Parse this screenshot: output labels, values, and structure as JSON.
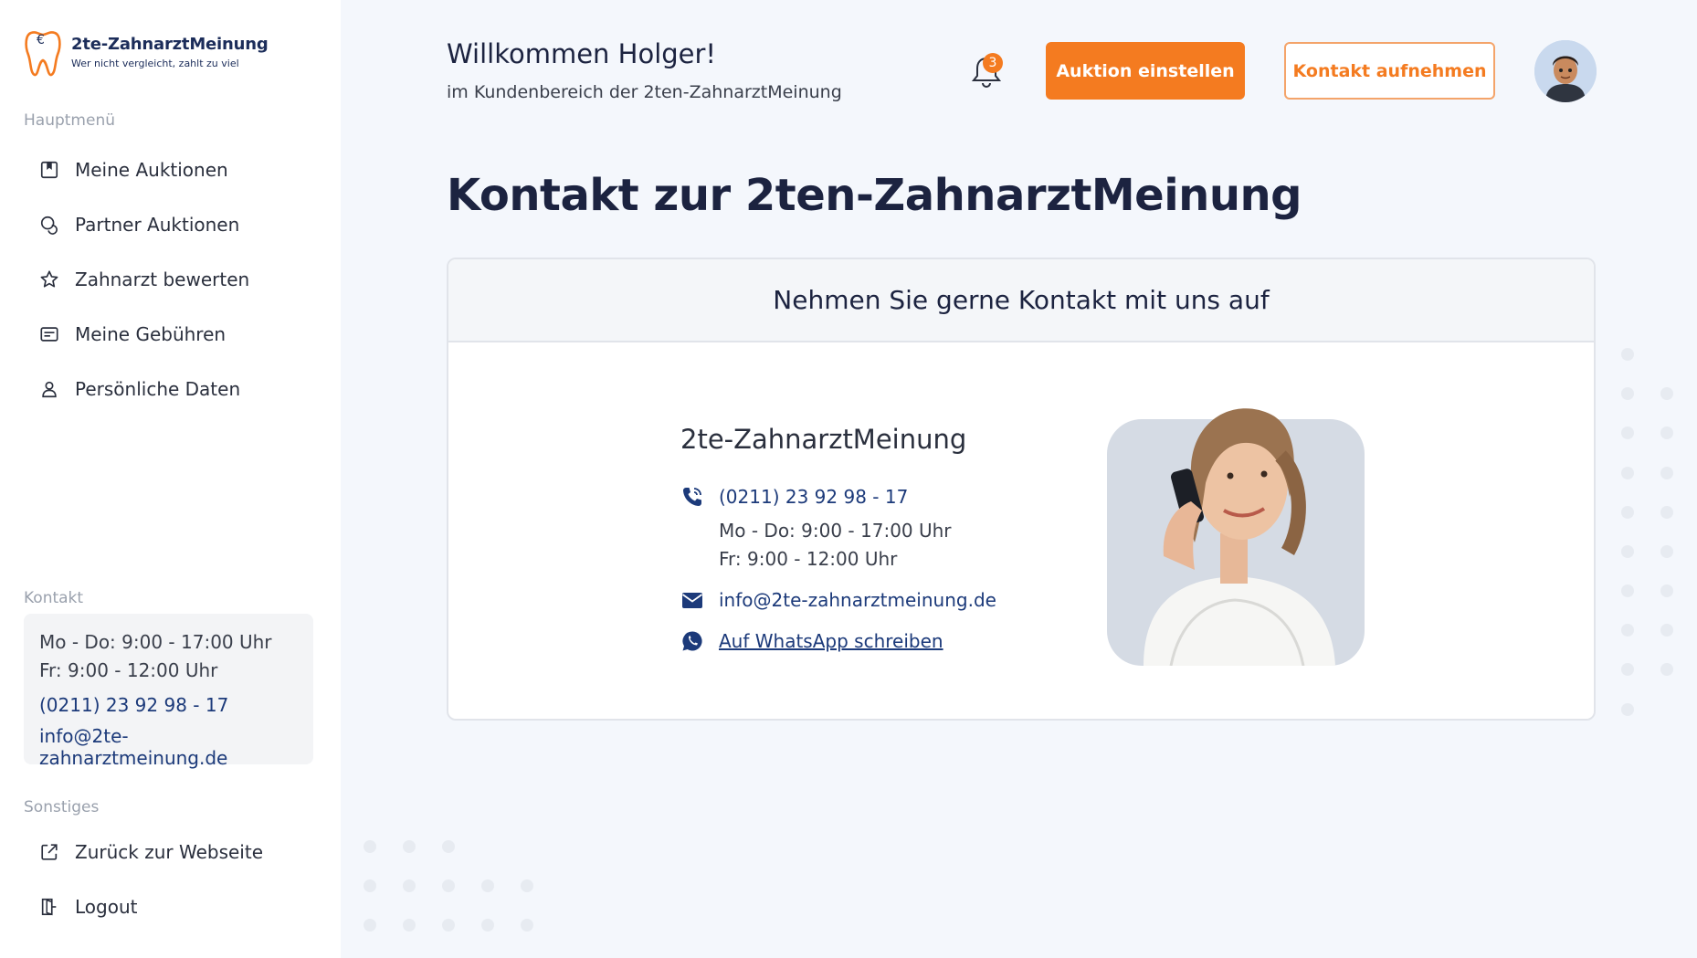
{
  "brand": {
    "name": "2te-ZahnarztMeinung",
    "tagline": "Wer nicht vergleicht, zahlt zu viel",
    "accent": "#f47b20",
    "navy": "#1c2d5a"
  },
  "sidebar": {
    "main_label": "Hauptmenü",
    "items": [
      {
        "label": "Meine Auktionen",
        "icon": "bookmark-icon"
      },
      {
        "label": "Partner Auktionen",
        "icon": "chat-bubbles-icon"
      },
      {
        "label": "Zahnarzt bewerten",
        "icon": "star-icon"
      },
      {
        "label": "Meine Gebühren",
        "icon": "card-icon"
      },
      {
        "label": "Persönliche Daten",
        "icon": "user-icon"
      }
    ],
    "contact_label": "Kontakt",
    "contact": {
      "hours_1": "Mo - Do: 9:00 - 17:00 Uhr",
      "hours_2": "Fr: 9:00 - 12:00 Uhr",
      "phone": "(0211) 23 92 98 - 17",
      "email": "info@2te-zahnarztmeinung.de"
    },
    "other_label": "Sonstiges",
    "other_items": [
      {
        "label": "Zurück zur Webseite",
        "icon": "external-link-icon"
      },
      {
        "label": "Logout",
        "icon": "logout-door-icon"
      }
    ]
  },
  "header": {
    "greeting": "Willkommen Holger!",
    "subtitle": "im Kundenbereich der 2ten-ZahnarztMeinung",
    "notification_count": "3",
    "primary_button": "Auktion einstellen",
    "secondary_button": "Kontakt aufnehmen"
  },
  "page": {
    "title": "Kontakt zur 2ten-ZahnarztMeinung"
  },
  "card": {
    "heading": "Nehmen Sie gerne Kontakt mit uns auf",
    "company": "2te-ZahnarztMeinung",
    "phone": "(0211) 23 92 98 - 17",
    "hours_1": "Mo - Do: 9:00 - 17:00 Uhr",
    "hours_2": "Fr: 9:00 - 12:00 Uhr",
    "email": "info@2te-zahnarztmeinung.de",
    "whatsapp": "Auf WhatsApp schreiben"
  }
}
